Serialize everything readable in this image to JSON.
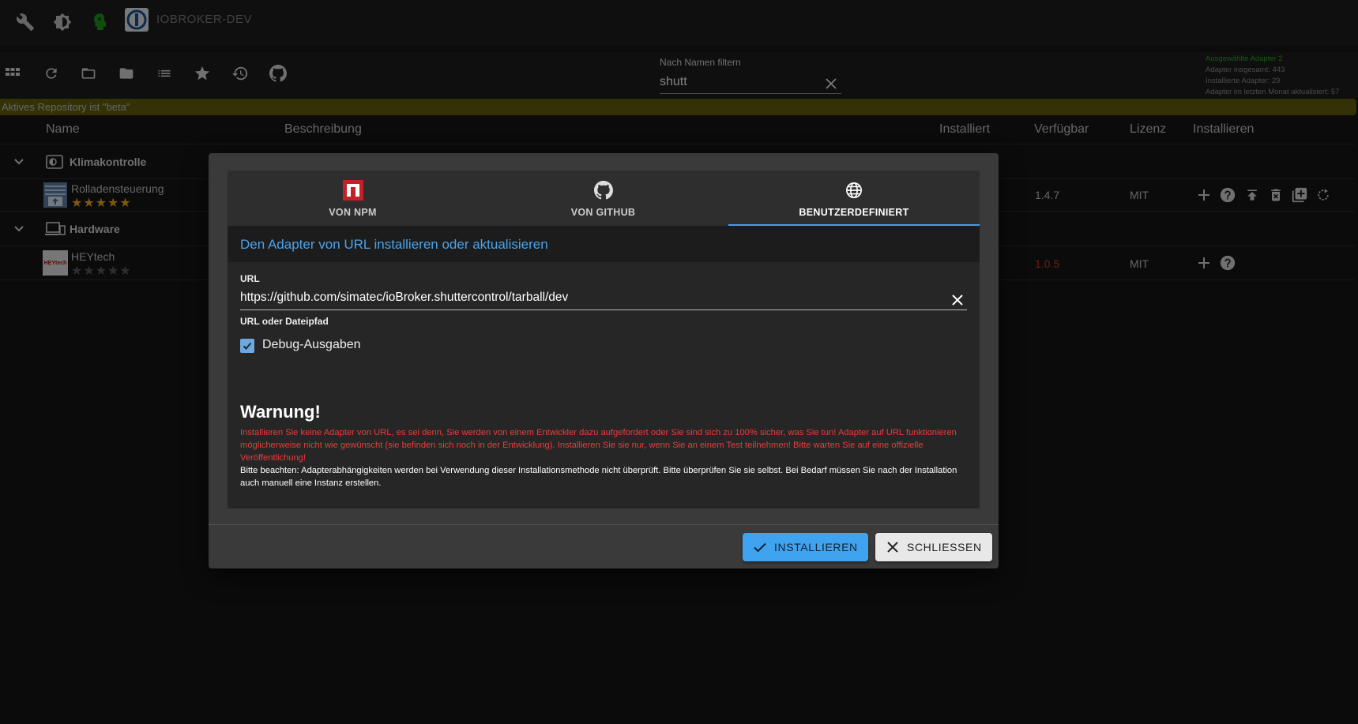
{
  "header": {
    "title": "IOBROKER-DEV",
    "icons": [
      "wrench-icon",
      "brightness-icon",
      "expert-mode-icon"
    ]
  },
  "toolbar": {
    "icons": [
      "grid-view-icon",
      "refresh-icon",
      "folder-open-icon",
      "folder-icon",
      "list-icon",
      "star-icon",
      "update-history-icon",
      "github-icon"
    ],
    "filter_label": "Nach Namen filtern",
    "filter_value": "shutt"
  },
  "stats": {
    "selected": "Ausgewählte Adapter 2",
    "total": "Adapter insgesamt: 443",
    "installed": "Installierte Adapter: 29",
    "updated_last_month": "Adapter im letzten Monat aktualisiert: 57"
  },
  "repo_banner": "Aktives Repository ist \"beta\"",
  "table": {
    "headers": {
      "name": "Name",
      "description": "Beschreibung",
      "installed": "Installiert",
      "available": "Verfügbar",
      "license": "Lizenz",
      "install": "Installieren"
    },
    "groups": [
      {
        "title": "Klimakontrolle",
        "adapter": {
          "name": "Rolladensteuerung",
          "rating": 5,
          "available": "1.4.7",
          "license": "MIT"
        }
      },
      {
        "title": "Hardware",
        "adapter": {
          "name": "HEYtech",
          "logo_text": "HEYtech",
          "rating": 0,
          "available": "1.0.5",
          "license": "MIT"
        }
      }
    ],
    "colors": {
      "star_active": "#e3a41c",
      "star_inactive": "#555555",
      "version_outdated": "#c0392b"
    }
  },
  "dialog": {
    "tabs": [
      {
        "label": "VON NPM",
        "icon": "npm-icon"
      },
      {
        "label": "VON GITHUB",
        "icon": "github-icon"
      },
      {
        "label": "BENUTZERDEFINIERT",
        "icon": "globe-icon",
        "active": true
      }
    ],
    "title": "Den Adapter von URL installieren oder aktualisieren",
    "url_label": "URL",
    "url_value": "https://github.com/simatec/ioBroker.shuttercontrol/tarball/dev",
    "url_helper": "URL oder Dateipfad",
    "debug_label": "Debug-Ausgaben",
    "debug_checked": true,
    "warning_title": "Warnung!",
    "warning_text": "Installieren Sie keine Adapter von URL, es sei denn, Sie werden von einem Entwickler dazu aufgefordert oder Sie sind sich zu 100% sicher, was Sie tun! Adapter auf URL funktionieren möglicherweise nicht wie gewünscht (sie befinden sich noch in der Entwicklung). Installieren Sie sie nur, wenn Sie an einem Test teilnehmen! Bitte warten Sie auf eine offizielle Veröffentlichung!",
    "note_text": "Bitte beachten: Adapterabhängigkeiten werden bei Verwendung dieser Installationsmethode nicht überprüft. Bitte überprüfen Sie sie selbst. Bei Bedarf müssen Sie nach der Installation auch manuell eine Instanz erstellen.",
    "install_button": "INSTALLIEREN",
    "close_button": "SCHLIESSEN",
    "accent": "#4aa3ec",
    "warning_color": "#ee3b3b"
  }
}
